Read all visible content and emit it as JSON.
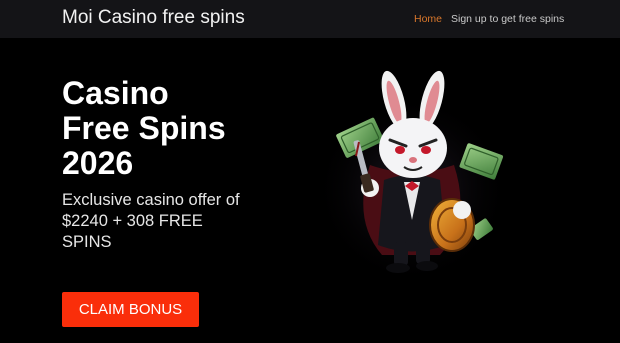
{
  "navbar": {
    "brand": "Moi Casino free spins",
    "links": [
      {
        "label": "Home",
        "active": true
      },
      {
        "label": "Sign up to get free spins",
        "active": false
      }
    ]
  },
  "hero": {
    "title_lines": [
      "Casino",
      "Free Spins",
      "2026"
    ],
    "offer_lines": [
      "Exclusive casino offer of",
      "$2240 + 308 FREE",
      "SPINS"
    ],
    "cta_label": "CLAIM BONUS"
  },
  "illustration": {
    "icon": "rabbit-magician-mascot-icon"
  },
  "colors": {
    "background": "#000000",
    "navbar": "#141417",
    "nav_active": "#d9772b",
    "cta": "#fa2e0a"
  }
}
